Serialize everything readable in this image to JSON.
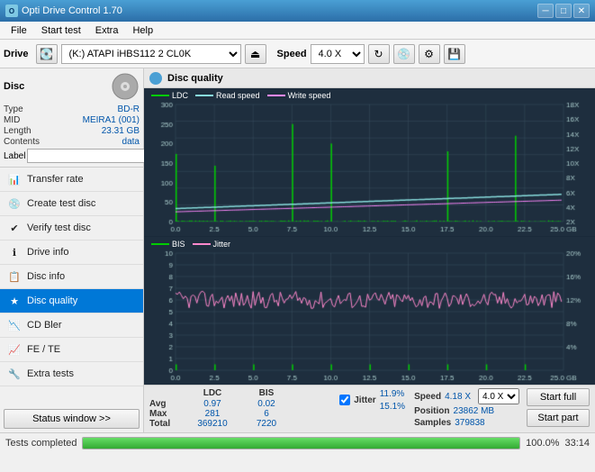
{
  "app": {
    "title": "Opti Drive Control 1.70",
    "icon_text": "O"
  },
  "menu": {
    "items": [
      "File",
      "Start test",
      "Extra",
      "Help"
    ]
  },
  "toolbar": {
    "drive_label": "Drive",
    "drive_value": "(K:)  ATAPI iHBS112  2 CL0K",
    "speed_label": "Speed",
    "speed_value": "4.0 X"
  },
  "disc": {
    "title": "Disc",
    "type_label": "Type",
    "type_value": "BD-R",
    "mid_label": "MID",
    "mid_value": "MEIRA1 (001)",
    "length_label": "Length",
    "length_value": "23.31 GB",
    "contents_label": "Contents",
    "contents_value": "data",
    "label_label": "Label",
    "label_placeholder": ""
  },
  "nav": {
    "items": [
      {
        "id": "transfer-rate",
        "label": "Transfer rate",
        "icon": "📊"
      },
      {
        "id": "create-test-disc",
        "label": "Create test disc",
        "icon": "💿"
      },
      {
        "id": "verify-test-disc",
        "label": "Verify test disc",
        "icon": "✔"
      },
      {
        "id": "drive-info",
        "label": "Drive info",
        "icon": "ℹ"
      },
      {
        "id": "disc-info",
        "label": "Disc info",
        "icon": "📋"
      },
      {
        "id": "disc-quality",
        "label": "Disc quality",
        "icon": "★",
        "active": true
      },
      {
        "id": "cd-bler",
        "label": "CD Bler",
        "icon": "📉"
      },
      {
        "id": "fe-te",
        "label": "FE / TE",
        "icon": "📈"
      },
      {
        "id": "extra-tests",
        "label": "Extra tests",
        "icon": "🔧"
      }
    ]
  },
  "disc_quality": {
    "title": "Disc quality"
  },
  "chart_top": {
    "legend": [
      {
        "label": "LDC",
        "color": "#00aa00"
      },
      {
        "label": "Read speed",
        "color": "#00cccc"
      },
      {
        "label": "Write speed",
        "color": "#ff88ff"
      }
    ],
    "y_left_max": 300,
    "y_right_max": 18,
    "y_right_labels": [
      "18X",
      "16X",
      "14X",
      "12X",
      "10X",
      "8X",
      "6X",
      "4X",
      "2X"
    ],
    "x_labels": [
      "0.0",
      "2.5",
      "5.0",
      "7.5",
      "10.0",
      "12.5",
      "15.0",
      "17.5",
      "20.0",
      "22.5",
      "25.0 GB"
    ]
  },
  "chart_bottom": {
    "legend": [
      {
        "label": "BIS",
        "color": "#00aa00"
      },
      {
        "label": "Jitter",
        "color": "#ff88ff"
      }
    ],
    "y_left_max": 10,
    "y_right_max": 20,
    "y_right_labels": [
      "20%",
      "16%",
      "12%",
      "8%",
      "4%"
    ],
    "x_labels": [
      "0.0",
      "2.5",
      "5.0",
      "7.5",
      "10.0",
      "12.5",
      "15.0",
      "17.5",
      "20.0",
      "22.5",
      "25.0 GB"
    ]
  },
  "stats": {
    "col_headers": [
      "LDC",
      "BIS"
    ],
    "rows": [
      {
        "label": "Avg",
        "ldc": "0.97",
        "bis": "0.02"
      },
      {
        "label": "Max",
        "ldc": "281",
        "bis": "6"
      },
      {
        "label": "Total",
        "ldc": "369210",
        "bis": "7220"
      }
    ],
    "jitter": {
      "label": "Jitter",
      "checked": true,
      "avg": "11.9%",
      "max": "15.1%"
    },
    "speed": {
      "speed_label": "Speed",
      "speed_value": "4.18 X",
      "speed_dropdown": "4.0 X",
      "position_label": "Position",
      "position_value": "23862 MB",
      "samples_label": "Samples",
      "samples_value": "379838"
    },
    "buttons": {
      "start_full": "Start full",
      "start_part": "Start part"
    }
  },
  "bottom_bar": {
    "status_text": "Tests completed",
    "progress_percent": 100,
    "progress_display": "100.0%",
    "time_display": "33:14"
  },
  "colors": {
    "accent_blue": "#0078d7",
    "chart_bg": "#2b3a4a",
    "grid_line": "#3a4e60",
    "ldc_color": "#00cc00",
    "read_speed_color": "#88dddd",
    "write_speed_color": "#ff88ff",
    "bis_color": "#00cc00",
    "jitter_color": "#ff88cc"
  }
}
